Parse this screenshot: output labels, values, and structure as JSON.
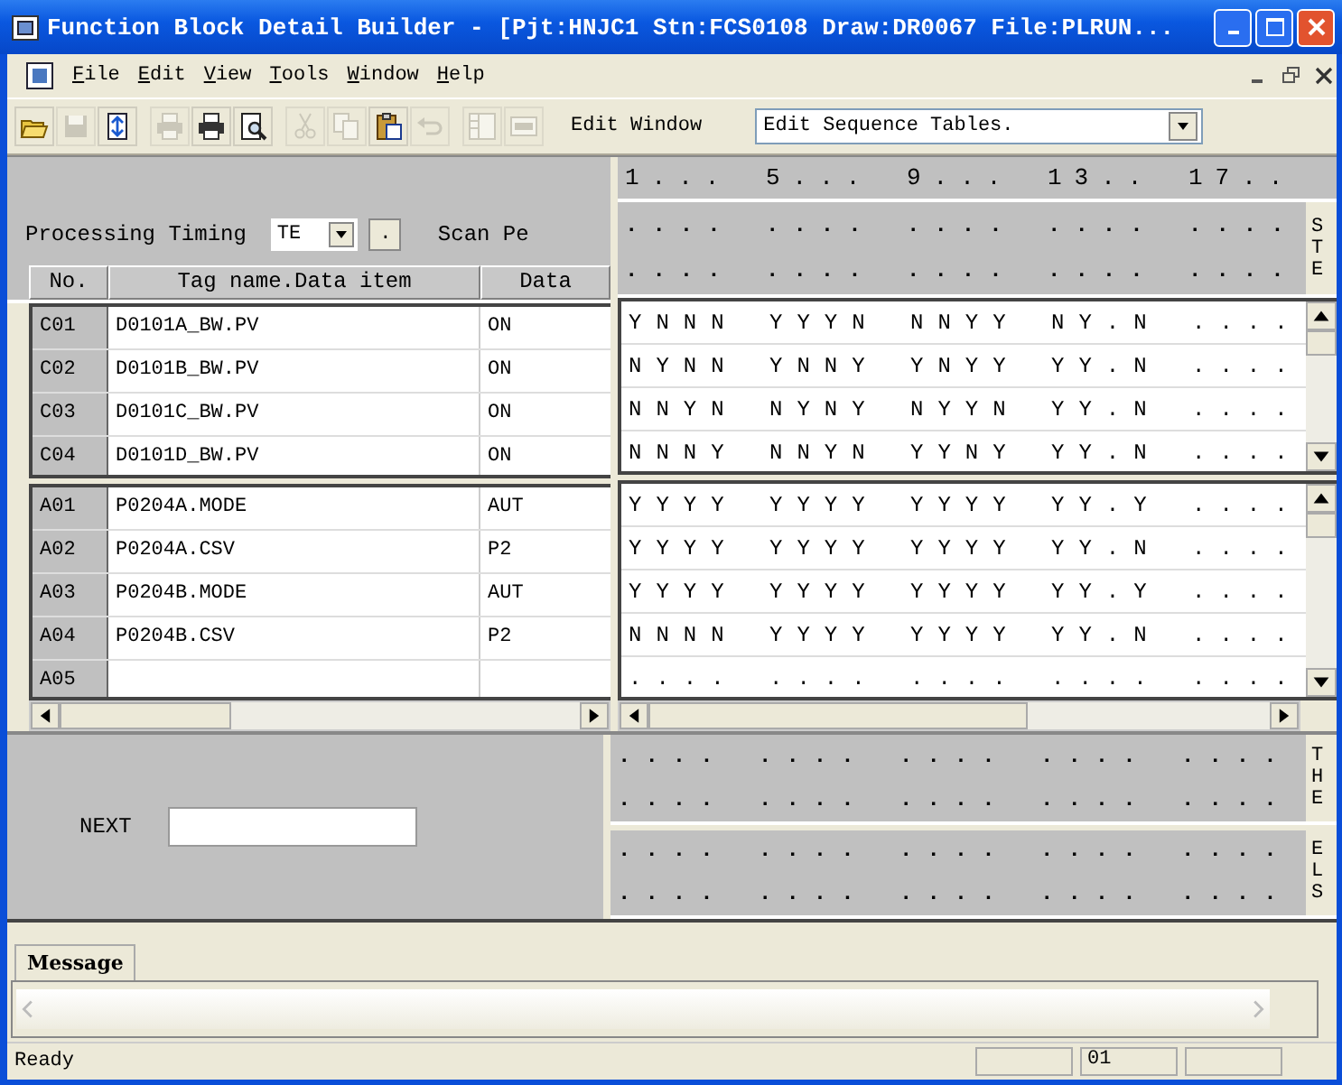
{
  "window": {
    "title": "Function Block Detail Builder - [Pjt:HNJC1 Stn:FCS0108 Draw:DR0067 File:PLRUN..."
  },
  "menu": [
    "File",
    "Edit",
    "View",
    "Tools",
    "Window",
    "Help"
  ],
  "toolbar": {
    "buttons": [
      {
        "kind": "open",
        "disabled": false
      },
      {
        "kind": "save",
        "disabled": true
      },
      {
        "kind": "properties",
        "disabled": false
      },
      {
        "kind": "print",
        "disabled": true
      },
      {
        "kind": "print",
        "disabled": false
      },
      {
        "kind": "preview",
        "disabled": false
      },
      {
        "kind": "cut",
        "disabled": true
      },
      {
        "kind": "copy",
        "disabled": true
      },
      {
        "kind": "paste",
        "disabled": false
      },
      {
        "kind": "undo",
        "disabled": true
      },
      {
        "kind": "panel",
        "disabled": true
      },
      {
        "kind": "window",
        "disabled": true
      }
    ],
    "label": "Edit Window",
    "view_select": {
      "value": "Edit Sequence Tables."
    }
  },
  "timing": {
    "label": "Processing Timing",
    "value": "TE",
    "button": ".",
    "scan_label": "Scan Pe"
  },
  "columns": [
    "No.",
    "Tag name.Data item",
    "Data"
  ],
  "ruler": [
    "1...",
    "5...",
    "9...",
    "13..",
    "17.."
  ],
  "state_section": {
    "label": "STE",
    "rows": [
      [
        "....",
        "....",
        "....",
        "....",
        "...."
      ],
      [
        "....",
        "....",
        "....",
        "....",
        "...."
      ]
    ]
  },
  "conditions": [
    {
      "no": "C01",
      "tag": "D0101A_BW.PV",
      "data": "ON",
      "rules": [
        "YNNN",
        "YYYN",
        "NNYY",
        "NY.N",
        "...."
      ]
    },
    {
      "no": "C02",
      "tag": "D0101B_BW.PV",
      "data": "ON",
      "rules": [
        "NYNN",
        "YNNY",
        "YNYY",
        "YY.N",
        "...."
      ]
    },
    {
      "no": "C03",
      "tag": "D0101C_BW.PV",
      "data": "ON",
      "rules": [
        "NNYN",
        "NYNY",
        "NYYN",
        "YY.N",
        "...."
      ]
    },
    {
      "no": "C04",
      "tag": "D0101D_BW.PV",
      "data": "ON",
      "rules": [
        "NNNY",
        "NNYN",
        "YYNY",
        "YY.N",
        "...."
      ]
    }
  ],
  "actions": [
    {
      "no": "A01",
      "tag": "P0204A.MODE",
      "data": "AUT",
      "rules": [
        "YYYY",
        "YYYY",
        "YYYY",
        "YY.Y",
        "...."
      ]
    },
    {
      "no": "A02",
      "tag": "P0204A.CSV",
      "data": "P2",
      "rules": [
        "YYYY",
        "YYYY",
        "YYYY",
        "YY.N",
        "...."
      ]
    },
    {
      "no": "A03",
      "tag": "P0204B.MODE",
      "data": "AUT",
      "rules": [
        "YYYY",
        "YYYY",
        "YYYY",
        "YY.Y",
        "...."
      ]
    },
    {
      "no": "A04",
      "tag": "P0204B.CSV",
      "data": "P2",
      "rules": [
        "NNNN",
        "YYYY",
        "YYYY",
        "YY.N",
        "...."
      ]
    },
    {
      "no": "A05",
      "rules": [
        "....",
        "....",
        "....",
        "....",
        "...."
      ]
    }
  ],
  "next": {
    "label": "NEXT"
  },
  "then_section": {
    "label": "THE",
    "rows": [
      [
        "....",
        "....",
        "....",
        "....",
        "...."
      ],
      [
        "....",
        "....",
        "....",
        "....",
        "...."
      ]
    ]
  },
  "else_section": {
    "label": "ELS",
    "rows": [
      [
        "....",
        "....",
        "....",
        "....",
        "...."
      ],
      [
        "....",
        "....",
        "....",
        "....",
        "...."
      ]
    ]
  },
  "message_tab": {
    "label": "Message",
    "selected": true
  },
  "status_bar": {
    "text": "Ready",
    "panel_2": "01"
  }
}
